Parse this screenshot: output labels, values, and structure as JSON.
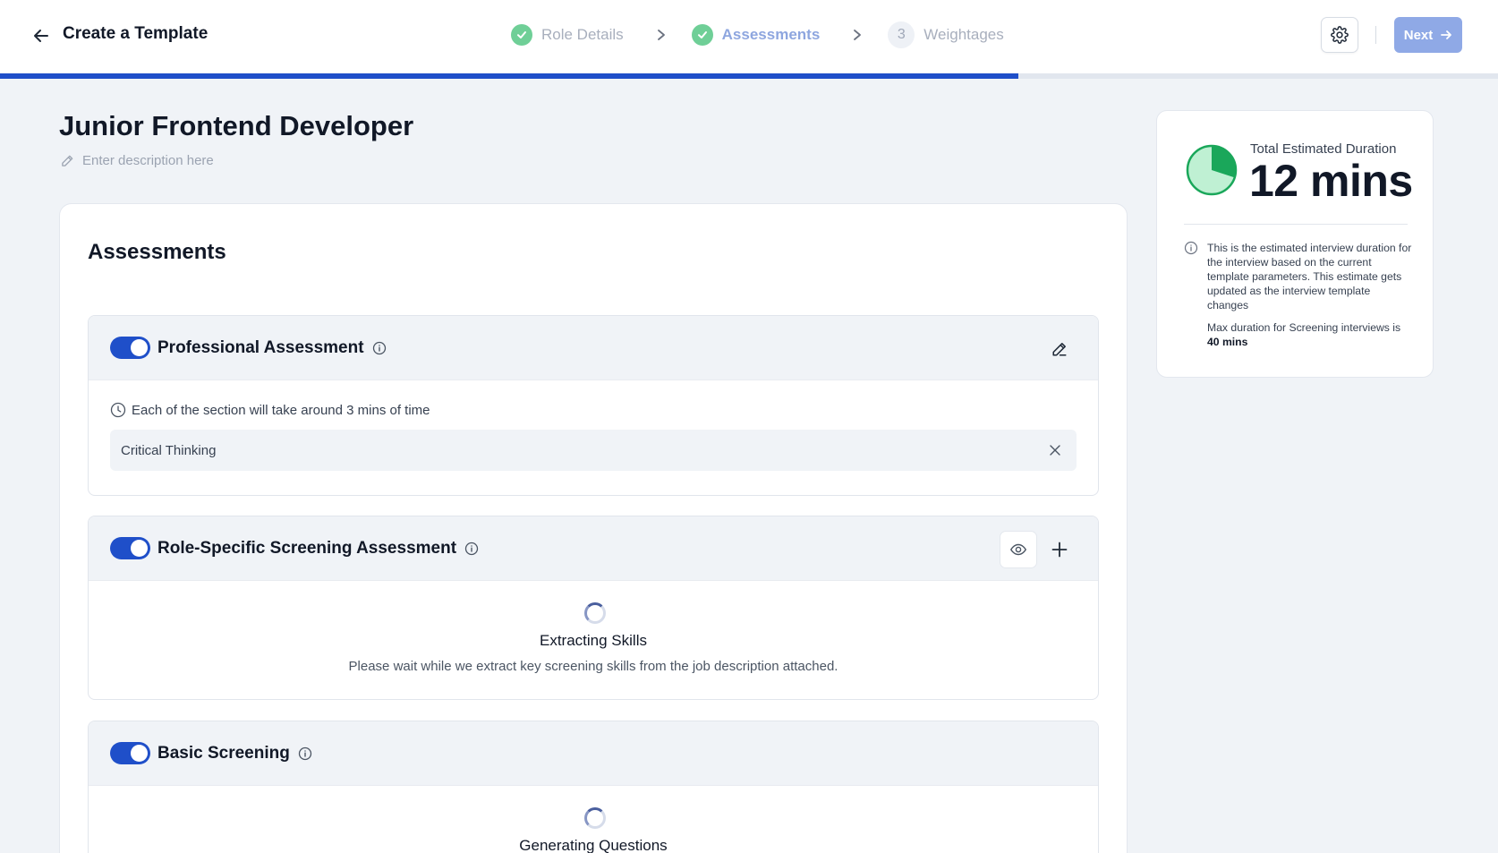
{
  "header": {
    "title": "Create a Template",
    "steps": [
      {
        "label": "Role Details",
        "status": "done"
      },
      {
        "label": "Assessments",
        "status": "active"
      },
      {
        "number": "3",
        "label": "Weightages",
        "status": "pending"
      }
    ],
    "next_label": "Next",
    "progress_fraction": 0.68
  },
  "role": {
    "title": "Junior Frontend Developer",
    "description_placeholder": "Enter description here"
  },
  "assessments": {
    "heading": "Assessments",
    "sections": [
      {
        "title": "Professional Assessment",
        "enabled": true,
        "time_note": "Each of the section will take around 3 mins of time",
        "skills": [
          "Critical Thinking"
        ]
      },
      {
        "title": "Role-Specific Screening Assessment",
        "enabled": true,
        "loading_title": "Extracting Skills",
        "loading_subtitle": "Please wait while we extract key screening skills from the job description attached."
      },
      {
        "title": "Basic Screening",
        "enabled": true,
        "loading_title": "Generating Questions"
      }
    ]
  },
  "duration": {
    "label": "Total Estimated Duration",
    "value": "12 mins",
    "fraction_of_max": 0.3,
    "note": "This is the estimated interview duration for the interview based on the current template parameters. This estimate gets updated as the interview template changes",
    "max_prefix": "Max duration for Screening interviews is",
    "max_value": "40 mins"
  },
  "colors": {
    "primary": "#1f4fc9",
    "step_done": "#6fcf97",
    "next_disabled": "#8fa9e6",
    "pie_fill": "#1aa75a",
    "pie_bg": "#bff0d3"
  }
}
